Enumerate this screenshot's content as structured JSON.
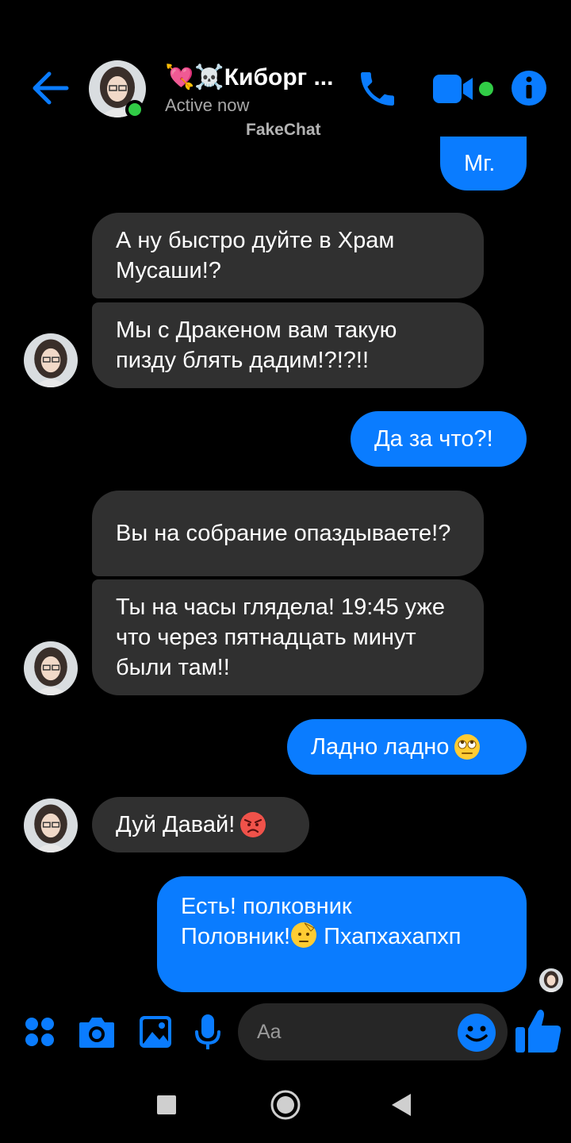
{
  "header": {
    "title": "💘☠️Киборг ...",
    "status": "Active now",
    "watermark": "FakeChat"
  },
  "messages": {
    "m0": "Мг.",
    "m1": "А ну быстро дуйте в Храм Мусаши!?",
    "m2": "Мы с Дракеном вам такую пизду блять дадим!?!?!!",
    "m3": "Да за что?!",
    "m4": "Вы на собрание опаздываете!?",
    "m5": "Ты на часы глядела! 19:45 уже что через пятнадцать минут были там!!",
    "m6": "Ладно ладно",
    "m7": "Дуй Давай!",
    "m8a": "Есть! полковник",
    "m8b": "Половник!",
    "m8c": " Пхапхахапхп"
  },
  "composer": {
    "placeholder": "Aa"
  },
  "colors": {
    "accent": "#0a7cff",
    "incoming_bubble": "#303030",
    "online": "#31cc46",
    "background": "#000000"
  },
  "icons": {
    "back": "back-arrow-icon",
    "call": "phone-icon",
    "video": "video-camera-icon",
    "info": "info-icon",
    "apps": "apps-grid-icon",
    "camera": "camera-icon",
    "gallery": "image-icon",
    "mic": "microphone-icon",
    "emoji": "smile-icon",
    "like": "thumbs-up-icon"
  }
}
